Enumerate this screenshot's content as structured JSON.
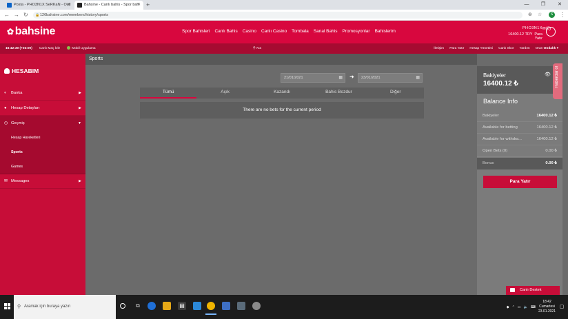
{
  "browser": {
    "tabs": [
      {
        "label": "Posta - PHO3N1X SeRKaN - Outl",
        "active": false
      },
      {
        "label": "Bahsine - Canlı bahis - Spor bah",
        "active": true
      }
    ],
    "url": "126bahsine.com/members/history/sports",
    "profile_initial": "S"
  },
  "site": {
    "brand": "bahsine",
    "nav": [
      "Spor Bahisleri",
      "Canlı Bahis",
      "Casino",
      "Canlı Casino",
      "Tombala",
      "Sanal Bahis",
      "Promosyonlar",
      "Bahislerim"
    ],
    "user": {
      "name": "PHO3N1X",
      "messages": "(0)",
      "balance": "16400.12 TRY",
      "deposit_label": "Para Yatır"
    },
    "subheader": {
      "time": "16:42:30 (+03:00)",
      "live_tv": "Canlı Maç İzle",
      "mobile": "Mobil Uygulama",
      "search": "Ara",
      "links": [
        "İletişim",
        "Para Yatır",
        "Hesap Yönetimi",
        "Canlı Skor",
        "Yardım"
      ],
      "odds_label": "Oran",
      "odds_value": "Ondalık"
    }
  },
  "sidebar": {
    "title": "HESABIM",
    "items": [
      {
        "label": "Banka"
      },
      {
        "label": "Hesap Detayları"
      },
      {
        "label": "Geçmiş"
      }
    ],
    "subitems": [
      {
        "label": "Hesap Hareketleri"
      },
      {
        "label": "Sports"
      },
      {
        "label": "Games"
      }
    ],
    "messages_label": "Messages"
  },
  "main": {
    "section_title": "Sports",
    "date_from": "21/01/2021",
    "date_to": "23/01/2021",
    "filters": [
      "Tümü",
      "Açık",
      "Kazandı",
      "Bahis Bozdur",
      "Diğer"
    ],
    "active_filter": 0,
    "empty_message": "There are no bets for the current period"
  },
  "balance_panel": {
    "label": "Bakiyeler",
    "amount": "16400.12 ₺",
    "info_title": "Balance Info",
    "rows": [
      {
        "label": "Bakiyeler",
        "value": "16400.12 ₺"
      },
      {
        "label": "Available for betting",
        "value": "16400.12 ₺"
      },
      {
        "label": "Available for withdra...",
        "value": "16400.12 ₺"
      },
      {
        "label": "Open Bets (0)",
        "value": "0.00 ₺"
      },
      {
        "label": "Bonus",
        "value": "0.00 ₺"
      }
    ],
    "deposit_button": "Para Yatır"
  },
  "haberdar_label": "Haberdar ol",
  "live_support_label": "Canlı Destek",
  "taskbar": {
    "search_placeholder": "Aramak için buraya yazın",
    "time": "18:42",
    "day": "Cumartesi",
    "date": "23.01.2021"
  },
  "colors": {
    "brand_red": "#d8073e",
    "dark_red": "#a60b31",
    "panel_gray": "#595959"
  }
}
